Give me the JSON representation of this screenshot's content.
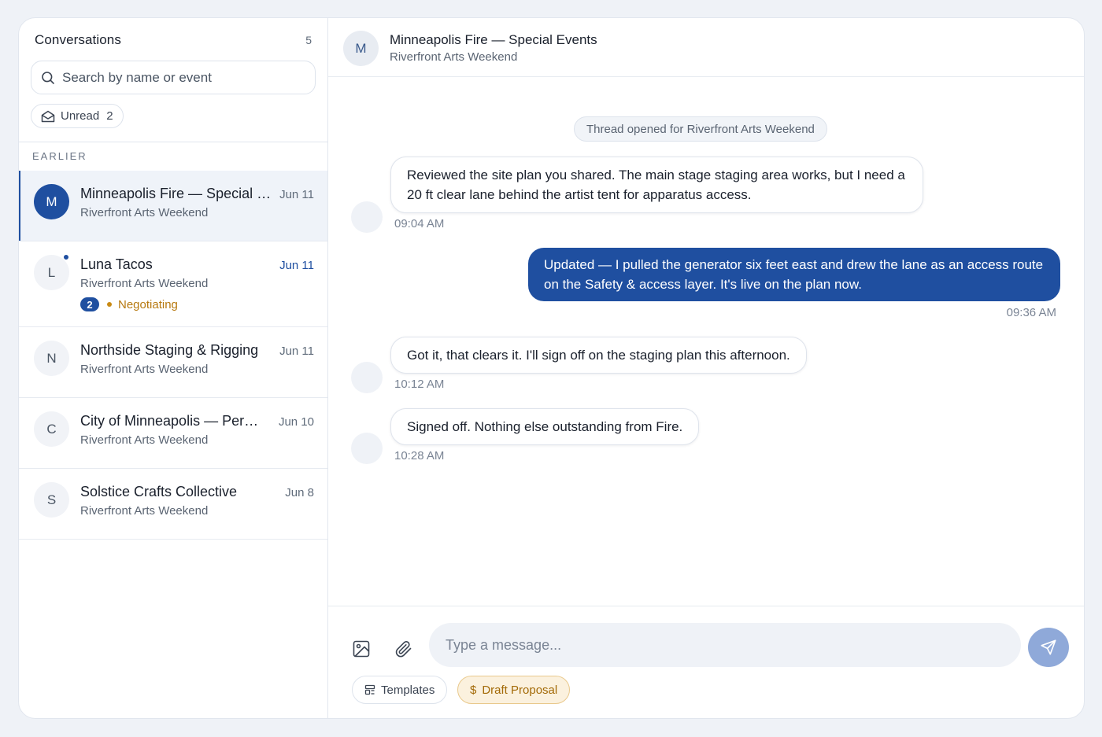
{
  "sidebar": {
    "title": "Conversations",
    "count": "5",
    "search_placeholder": "Search by name or event",
    "unread_label": "Unread",
    "unread_count": "2",
    "section_label": "EARLIER",
    "conversations": [
      {
        "initial": "M",
        "name": "Minneapolis Fire — Special Events",
        "event": "Riverfront Arts Weekend",
        "date": "Jun 11",
        "active": true
      },
      {
        "initial": "L",
        "name": "Luna Tacos",
        "event": "Riverfront Arts Weekend",
        "date": "Jun 11",
        "unread": true,
        "badge": "2",
        "status": "Negotiating"
      },
      {
        "initial": "N",
        "name": "Northside Staging & Rigging",
        "event": "Riverfront Arts Weekend",
        "date": "Jun 11"
      },
      {
        "initial": "C",
        "name": "City of Minneapolis — Permits",
        "event": "Riverfront Arts Weekend",
        "date": "Jun 10"
      },
      {
        "initial": "S",
        "name": "Solstice Crafts Collective",
        "event": "Riverfront Arts Weekend",
        "date": "Jun 8"
      }
    ]
  },
  "thread": {
    "initial": "M",
    "title": "Minneapolis Fire — Special Events",
    "subtitle": "Riverfront Arts Weekend",
    "system_note": "Thread opened for Riverfront Arts Weekend",
    "messages": [
      {
        "direction": "in",
        "text": "Reviewed the site plan you shared. The main stage staging area works, but I need a 20 ft clear lane behind the artist tent for apparatus access.",
        "time": "09:04 AM"
      },
      {
        "direction": "out",
        "text": "Updated — I pulled the generator six feet east and drew the lane as an access route on the Safety & access layer. It's live on the plan now.",
        "time": "09:36 AM"
      },
      {
        "direction": "in",
        "text": "Got it, that clears it. I'll sign off on the staging plan this afternoon.",
        "time": "10:12 AM"
      },
      {
        "direction": "in",
        "text": "Signed off. Nothing else outstanding from Fire.",
        "time": "10:28 AM"
      }
    ]
  },
  "composer": {
    "placeholder": "Type a message...",
    "templates_label": "Templates",
    "proposal_label": "Draft Proposal"
  },
  "icons": {
    "search": "search-icon",
    "unread": "envelope-open-icon",
    "image": "image-icon",
    "attach": "paperclip-icon",
    "send": "send-icon",
    "templates": "layout-template-icon",
    "proposal": "dollar-icon"
  },
  "colors": {
    "accent": "#1f4fa0",
    "status_negotiating": "#b7790f",
    "send_disabled": "#8fa9d9"
  }
}
